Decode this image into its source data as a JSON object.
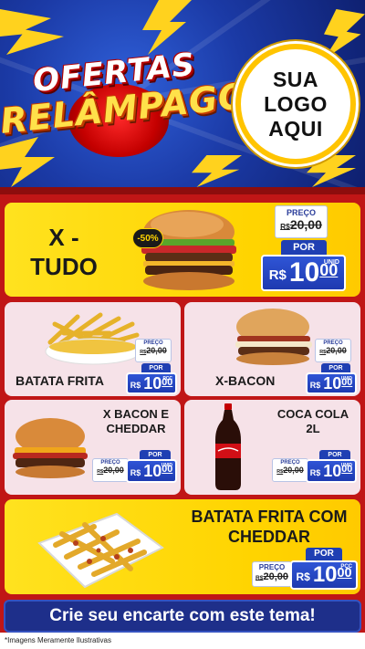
{
  "header": {
    "promo_line1": "OFERTAS",
    "promo_line2": "RELÂMPAGO",
    "logo_line1": "SUA",
    "logo_line2": "LOGO",
    "logo_line3": "AQUI"
  },
  "featured": {
    "name_line1": "X -",
    "name_line2": "TUDO",
    "discount": "-50%",
    "preco_label": "PREÇO",
    "old_currency": "R$",
    "old_price": "20,00",
    "por_label": "POR",
    "currency": "R$",
    "price_int": "10",
    "price_dec": "00",
    "unit": "UNID"
  },
  "items": [
    {
      "name": "BATATA FRITA",
      "preco_label": "PREÇO",
      "old_currency": "R$",
      "old_price": "20,00",
      "por_label": "POR",
      "currency": "R$",
      "price_int": "10",
      "price_dec": "00",
      "unit": "PÇC"
    },
    {
      "name": "X-BACON",
      "preco_label": "PREÇO",
      "old_currency": "R$",
      "old_price": "20,00",
      "por_label": "POR",
      "currency": "R$",
      "price_int": "10",
      "price_dec": "00",
      "unit": "UNID"
    },
    {
      "name_line1": "X BACON E",
      "name_line2": "CHEDDAR",
      "preco_label": "PREÇO",
      "old_currency": "R$",
      "old_price": "20,00",
      "por_label": "POR",
      "currency": "R$",
      "price_int": "10",
      "price_dec": "00",
      "unit": "UNID"
    },
    {
      "name_line1": "COCA COLA",
      "name_line2": "2L",
      "preco_label": "PREÇO",
      "old_currency": "R$",
      "old_price": "20,00",
      "por_label": "POR",
      "currency": "R$",
      "price_int": "10",
      "price_dec": "00",
      "unit": "UNID"
    }
  ],
  "bottom_item": {
    "name_line1": "BATATA FRITA COM",
    "name_line2": "CHEDDAR",
    "preco_label": "PREÇO",
    "old_currency": "R$",
    "old_price": "20,00",
    "por_label": "POR",
    "currency": "R$",
    "price_int": "10",
    "price_dec": "00",
    "unit": "PÇC"
  },
  "cta": "Crie seu encarte com este tema!",
  "disclaimer": "*Imagens Meramente Ilustrativas",
  "colors": {
    "header_blue": "#1b3aa6",
    "accent_yellow": "#ffd400",
    "background_red": "#c01616",
    "price_blue": "#1e3ab0",
    "card_pink": "#f6e2e8"
  }
}
